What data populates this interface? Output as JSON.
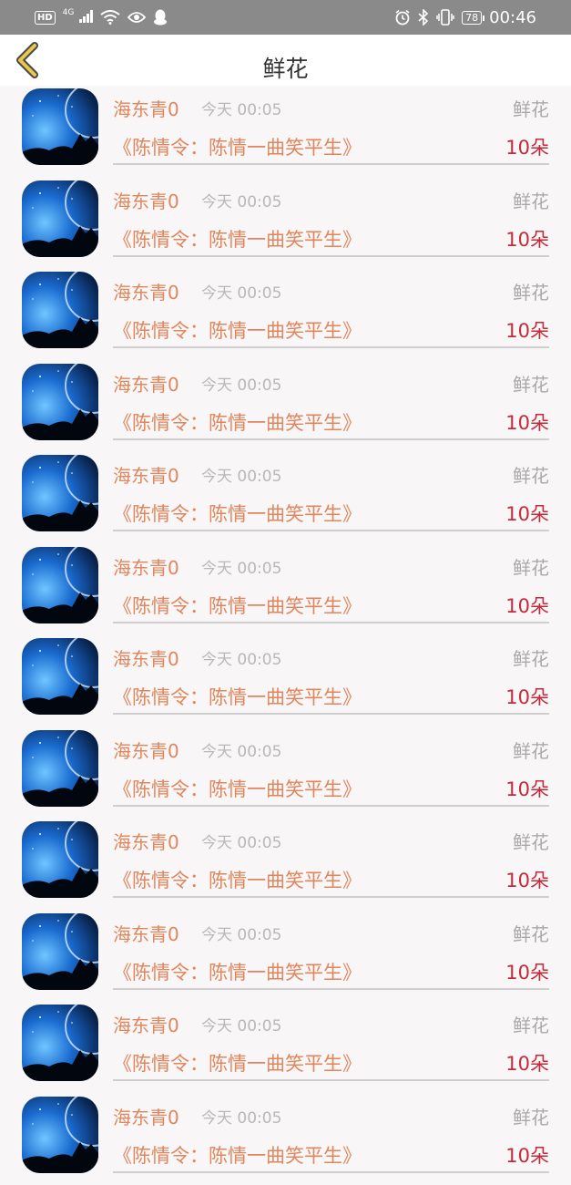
{
  "status_bar": {
    "hd": "HD",
    "network": "4G",
    "battery": "78",
    "time": "00:46",
    "icons": [
      "signal-icon",
      "wifi-icon",
      "eye-icon",
      "qq-icon",
      "alarm-icon",
      "bluetooth-icon",
      "vibrate-icon",
      "battery-icon"
    ]
  },
  "header": {
    "title": "鲜花",
    "back_icon": "chevron-left-icon",
    "accent": "#e8c84a"
  },
  "colors": {
    "name": "#e0865c",
    "count": "#c42a3a",
    "muted": "#a9a9a9"
  },
  "records": [
    {
      "name": "海东青0",
      "time": "今天 00:05",
      "gift": "鲜花",
      "song": "《陈情令：陈情一曲笑平生》",
      "count": "10朵"
    },
    {
      "name": "海东青0",
      "time": "今天 00:05",
      "gift": "鲜花",
      "song": "《陈情令：陈情一曲笑平生》",
      "count": "10朵"
    },
    {
      "name": "海东青0",
      "time": "今天 00:05",
      "gift": "鲜花",
      "song": "《陈情令：陈情一曲笑平生》",
      "count": "10朵"
    },
    {
      "name": "海东青0",
      "time": "今天 00:05",
      "gift": "鲜花",
      "song": "《陈情令：陈情一曲笑平生》",
      "count": "10朵"
    },
    {
      "name": "海东青0",
      "time": "今天 00:05",
      "gift": "鲜花",
      "song": "《陈情令：陈情一曲笑平生》",
      "count": "10朵"
    },
    {
      "name": "海东青0",
      "time": "今天 00:05",
      "gift": "鲜花",
      "song": "《陈情令：陈情一曲笑平生》",
      "count": "10朵"
    },
    {
      "name": "海东青0",
      "time": "今天 00:05",
      "gift": "鲜花",
      "song": "《陈情令：陈情一曲笑平生》",
      "count": "10朵"
    },
    {
      "name": "海东青0",
      "time": "今天 00:05",
      "gift": "鲜花",
      "song": "《陈情令：陈情一曲笑平生》",
      "count": "10朵"
    },
    {
      "name": "海东青0",
      "time": "今天 00:05",
      "gift": "鲜花",
      "song": "《陈情令：陈情一曲笑平生》",
      "count": "10朵"
    },
    {
      "name": "海东青0",
      "time": "今天 00:05",
      "gift": "鲜花",
      "song": "《陈情令：陈情一曲笑平生》",
      "count": "10朵"
    },
    {
      "name": "海东青0",
      "time": "今天 00:05",
      "gift": "鲜花",
      "song": "《陈情令：陈情一曲笑平生》",
      "count": "10朵"
    },
    {
      "name": "海东青0",
      "time": "今天 00:05",
      "gift": "鲜花",
      "song": "《陈情令：陈情一曲笑平生》",
      "count": "10朵"
    }
  ]
}
